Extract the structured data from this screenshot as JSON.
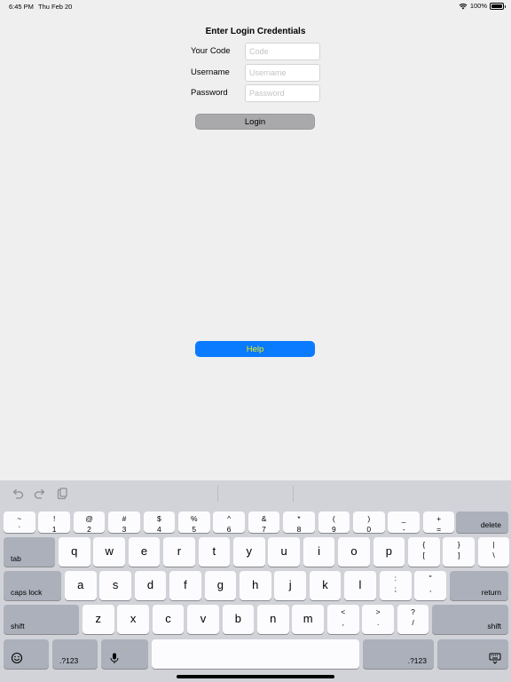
{
  "status_bar": {
    "time": "6:45 PM",
    "date": "Thu Feb 20",
    "battery": "100%",
    "battery_level": 1.0
  },
  "form": {
    "title": "Enter Login Credentials",
    "fields": [
      {
        "label": "Your Code",
        "value": "",
        "placeholder": "Code"
      },
      {
        "label": "Username",
        "value": "",
        "placeholder": "Username"
      },
      {
        "label": "Password",
        "value": "",
        "placeholder": "Password"
      }
    ],
    "login_label": "Login",
    "help_label": "Help"
  },
  "colors": {
    "background": "#efeff0",
    "login_button": "#a9a9ab",
    "help_button": "#0a7aff",
    "help_text": "#f4f000",
    "keyboard": "#d1d3d9"
  },
  "keyboard": {
    "toolbar_icons": [
      "undo-icon",
      "redo-icon",
      "paste-icon"
    ],
    "number_row": [
      {
        "top": "~",
        "bottom": "`"
      },
      {
        "top": "!",
        "bottom": "1"
      },
      {
        "top": "@",
        "bottom": "2"
      },
      {
        "top": "#",
        "bottom": "3"
      },
      {
        "top": "$",
        "bottom": "4"
      },
      {
        "top": "%",
        "bottom": "5"
      },
      {
        "top": "^",
        "bottom": "6"
      },
      {
        "top": "&",
        "bottom": "7"
      },
      {
        "top": "*",
        "bottom": "8"
      },
      {
        "top": "(",
        "bottom": "9"
      },
      {
        "top": ")",
        "bottom": "0"
      },
      {
        "top": "_",
        "bottom": "-"
      },
      {
        "top": "+",
        "bottom": "="
      }
    ],
    "delete_label": "delete",
    "tab_label": "tab",
    "row_q": [
      "q",
      "w",
      "e",
      "r",
      "t",
      "y",
      "u",
      "i",
      "o",
      "p"
    ],
    "row_q_symbols": [
      {
        "top": "{",
        "bottom": "["
      },
      {
        "top": "}",
        "bottom": "]"
      },
      {
        "top": "|",
        "bottom": "\\"
      }
    ],
    "caps_label": "caps lock",
    "row_a": [
      "a",
      "s",
      "d",
      "f",
      "g",
      "h",
      "j",
      "k",
      "l"
    ],
    "row_a_symbols": [
      {
        "top": ":",
        "bottom": ";"
      },
      {
        "top": "\"",
        "bottom": ","
      }
    ],
    "return_label": "return",
    "shift_label": "shift",
    "row_z": [
      "z",
      "x",
      "c",
      "v",
      "b",
      "n",
      "m"
    ],
    "row_z_symbols": [
      {
        "top": "<",
        "bottom": ","
      },
      {
        "top": ">",
        "bottom": "."
      },
      {
        "top": "?",
        "bottom": "/"
      }
    ],
    "numbers_label": ".?123"
  }
}
